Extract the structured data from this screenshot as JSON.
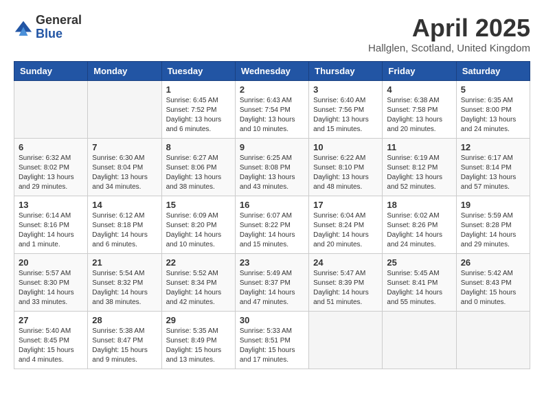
{
  "header": {
    "logo_general": "General",
    "logo_blue": "Blue",
    "month_title": "April 2025",
    "location": "Hallglen, Scotland, United Kingdom"
  },
  "weekdays": [
    "Sunday",
    "Monday",
    "Tuesday",
    "Wednesday",
    "Thursday",
    "Friday",
    "Saturday"
  ],
  "weeks": [
    [
      {
        "day": "",
        "info": ""
      },
      {
        "day": "",
        "info": ""
      },
      {
        "day": "1",
        "info": "Sunrise: 6:45 AM\nSunset: 7:52 PM\nDaylight: 13 hours and 6 minutes."
      },
      {
        "day": "2",
        "info": "Sunrise: 6:43 AM\nSunset: 7:54 PM\nDaylight: 13 hours and 10 minutes."
      },
      {
        "day": "3",
        "info": "Sunrise: 6:40 AM\nSunset: 7:56 PM\nDaylight: 13 hours and 15 minutes."
      },
      {
        "day": "4",
        "info": "Sunrise: 6:38 AM\nSunset: 7:58 PM\nDaylight: 13 hours and 20 minutes."
      },
      {
        "day": "5",
        "info": "Sunrise: 6:35 AM\nSunset: 8:00 PM\nDaylight: 13 hours and 24 minutes."
      }
    ],
    [
      {
        "day": "6",
        "info": "Sunrise: 6:32 AM\nSunset: 8:02 PM\nDaylight: 13 hours and 29 minutes."
      },
      {
        "day": "7",
        "info": "Sunrise: 6:30 AM\nSunset: 8:04 PM\nDaylight: 13 hours and 34 minutes."
      },
      {
        "day": "8",
        "info": "Sunrise: 6:27 AM\nSunset: 8:06 PM\nDaylight: 13 hours and 38 minutes."
      },
      {
        "day": "9",
        "info": "Sunrise: 6:25 AM\nSunset: 8:08 PM\nDaylight: 13 hours and 43 minutes."
      },
      {
        "day": "10",
        "info": "Sunrise: 6:22 AM\nSunset: 8:10 PM\nDaylight: 13 hours and 48 minutes."
      },
      {
        "day": "11",
        "info": "Sunrise: 6:19 AM\nSunset: 8:12 PM\nDaylight: 13 hours and 52 minutes."
      },
      {
        "day": "12",
        "info": "Sunrise: 6:17 AM\nSunset: 8:14 PM\nDaylight: 13 hours and 57 minutes."
      }
    ],
    [
      {
        "day": "13",
        "info": "Sunrise: 6:14 AM\nSunset: 8:16 PM\nDaylight: 14 hours and 1 minute."
      },
      {
        "day": "14",
        "info": "Sunrise: 6:12 AM\nSunset: 8:18 PM\nDaylight: 14 hours and 6 minutes."
      },
      {
        "day": "15",
        "info": "Sunrise: 6:09 AM\nSunset: 8:20 PM\nDaylight: 14 hours and 10 minutes."
      },
      {
        "day": "16",
        "info": "Sunrise: 6:07 AM\nSunset: 8:22 PM\nDaylight: 14 hours and 15 minutes."
      },
      {
        "day": "17",
        "info": "Sunrise: 6:04 AM\nSunset: 8:24 PM\nDaylight: 14 hours and 20 minutes."
      },
      {
        "day": "18",
        "info": "Sunrise: 6:02 AM\nSunset: 8:26 PM\nDaylight: 14 hours and 24 minutes."
      },
      {
        "day": "19",
        "info": "Sunrise: 5:59 AM\nSunset: 8:28 PM\nDaylight: 14 hours and 29 minutes."
      }
    ],
    [
      {
        "day": "20",
        "info": "Sunrise: 5:57 AM\nSunset: 8:30 PM\nDaylight: 14 hours and 33 minutes."
      },
      {
        "day": "21",
        "info": "Sunrise: 5:54 AM\nSunset: 8:32 PM\nDaylight: 14 hours and 38 minutes."
      },
      {
        "day": "22",
        "info": "Sunrise: 5:52 AM\nSunset: 8:34 PM\nDaylight: 14 hours and 42 minutes."
      },
      {
        "day": "23",
        "info": "Sunrise: 5:49 AM\nSunset: 8:37 PM\nDaylight: 14 hours and 47 minutes."
      },
      {
        "day": "24",
        "info": "Sunrise: 5:47 AM\nSunset: 8:39 PM\nDaylight: 14 hours and 51 minutes."
      },
      {
        "day": "25",
        "info": "Sunrise: 5:45 AM\nSunset: 8:41 PM\nDaylight: 14 hours and 55 minutes."
      },
      {
        "day": "26",
        "info": "Sunrise: 5:42 AM\nSunset: 8:43 PM\nDaylight: 15 hours and 0 minutes."
      }
    ],
    [
      {
        "day": "27",
        "info": "Sunrise: 5:40 AM\nSunset: 8:45 PM\nDaylight: 15 hours and 4 minutes."
      },
      {
        "day": "28",
        "info": "Sunrise: 5:38 AM\nSunset: 8:47 PM\nDaylight: 15 hours and 9 minutes."
      },
      {
        "day": "29",
        "info": "Sunrise: 5:35 AM\nSunset: 8:49 PM\nDaylight: 15 hours and 13 minutes."
      },
      {
        "day": "30",
        "info": "Sunrise: 5:33 AM\nSunset: 8:51 PM\nDaylight: 15 hours and 17 minutes."
      },
      {
        "day": "",
        "info": ""
      },
      {
        "day": "",
        "info": ""
      },
      {
        "day": "",
        "info": ""
      }
    ]
  ]
}
